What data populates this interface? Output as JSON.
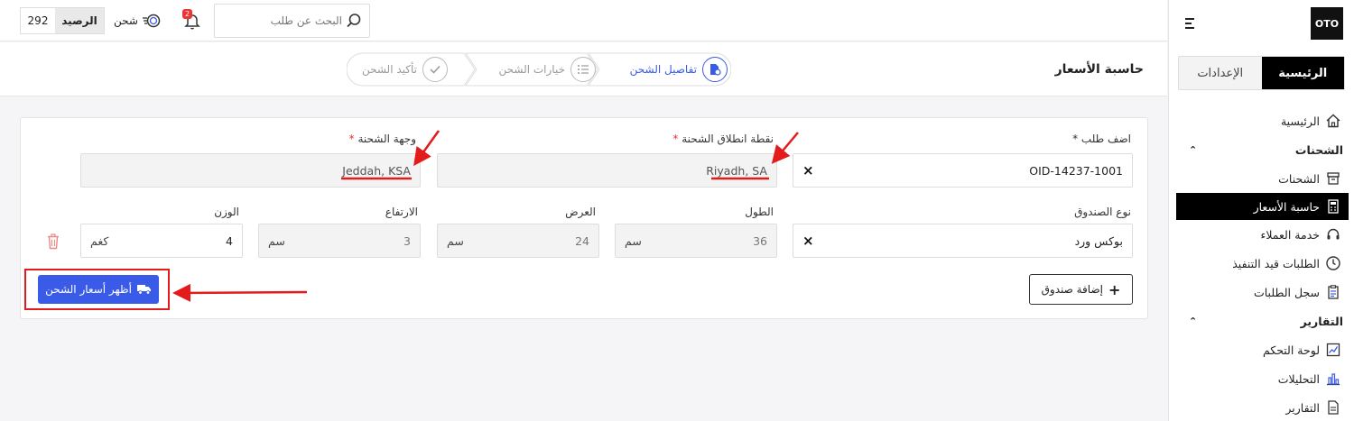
{
  "sidebar": {
    "logo": "OTO",
    "tabs": [
      {
        "label": "الرئيسية",
        "active": true
      },
      {
        "label": "الإعدادات",
        "active": false
      }
    ],
    "items": [
      {
        "label": "الرئيسية",
        "icon": "home-icon"
      },
      {
        "group": "الشحنات"
      },
      {
        "label": "الشحنات",
        "icon": "box-icon"
      },
      {
        "label": "حاسبة الأسعار",
        "icon": "calculator-icon",
        "active": true
      },
      {
        "label": "خدمة العملاء",
        "icon": "headset-icon"
      },
      {
        "label": "الطلبات قيد التنفيذ",
        "icon": "clock-icon"
      },
      {
        "label": "سجل الطلبات",
        "icon": "clipboard-icon"
      },
      {
        "group": "التقارير"
      },
      {
        "label": "لوحة التحكم",
        "icon": "dashboard-chart-icon"
      },
      {
        "label": "التحليلات",
        "icon": "bar-chart-icon"
      },
      {
        "label": "التقارير",
        "icon": "document-icon"
      }
    ]
  },
  "topbar": {
    "balance_value": "292",
    "balance_label": "الرصيد",
    "ship_label": "شحن",
    "notification_count": "2",
    "search_placeholder": "البحث عن طلب"
  },
  "page": {
    "title": "حاسبة الأسعار",
    "steps": [
      {
        "label": "تفاصيل الشحن",
        "active": true
      },
      {
        "label": "خيارات الشحن",
        "active": false
      },
      {
        "label": "تأكيد الشحن",
        "active": false
      }
    ]
  },
  "form": {
    "order_label": "اضف طلب *",
    "order_value": "OID-14237-1001",
    "origin_label": "نقطة انطلاق الشحنة",
    "origin_value": "Riyadh, SA",
    "destination_label": "وجهة الشحنة",
    "destination_value": "Jeddah, KSA",
    "required_mark": "*",
    "box_type_label": "نوع الصندوق",
    "box_type_value": "بوكس ورد",
    "length_label": "الطول",
    "length_value": "36",
    "width_label": "العرض",
    "width_value": "24",
    "height_label": "الارتفاع",
    "height_value": "3",
    "weight_label": "الوزن",
    "weight_value": "4",
    "unit_cm": "سم",
    "unit_kg": "كغم",
    "clear_mark": "×",
    "add_box_label": "إضافة صندوق",
    "show_prices_label": "أظهر أسعار الشحن"
  },
  "colors": {
    "accent": "#3a5ae8",
    "annotation": "#e31b1b",
    "active_nav": "#000000"
  }
}
